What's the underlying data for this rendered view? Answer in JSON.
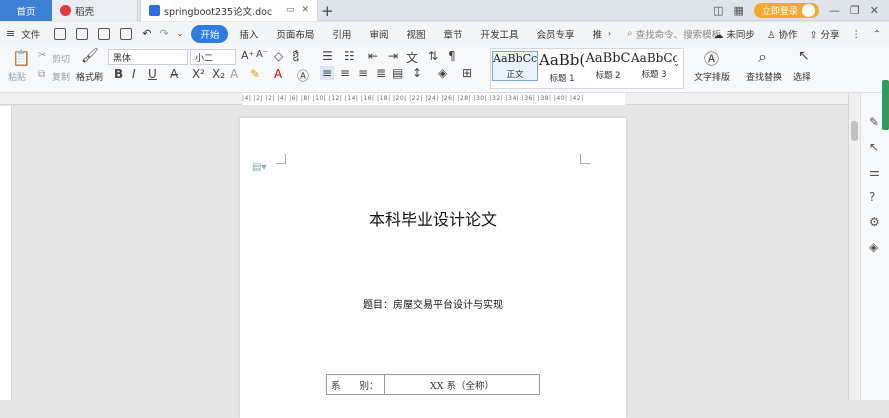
{
  "tabs": {
    "home": "首页",
    "daoke": "稻壳",
    "doc": "springboot235论文.doc"
  },
  "window": {
    "login_label": "立即登录"
  },
  "menu": {
    "file": "文件",
    "items": [
      "开始",
      "插入",
      "页面布局",
      "引用",
      "审阅",
      "视图",
      "章节",
      "开发工具",
      "会员专享",
      "推"
    ],
    "search_placeholder": "查找命令、搜索模板",
    "sync": "未同步",
    "collab": "协作",
    "share": "分享"
  },
  "ribbon": {
    "paste": "粘贴",
    "cut": "剪切",
    "copy": "复制",
    "format_painter": "格式刷",
    "font_name": "黑体",
    "font_size": "小二",
    "styles": [
      {
        "preview": "AaBbCcI",
        "label": "正文"
      },
      {
        "preview": "AaBb(",
        "label": "标题 1"
      },
      {
        "preview": "AaBbC",
        "label": "标题 2"
      },
      {
        "preview": "AaBbCc",
        "label": "标题 3"
      }
    ],
    "text_layout": "文字排版",
    "find_replace": "查找替换",
    "select": "选择"
  },
  "ruler": {
    "marks": "|4| |2| |2| |4| |6| |8| |10| |12| |14| |16| |18| |20| |22| |24| |26| |28| |30| |32| |34| |36| |38| |40| |42|"
  },
  "document": {
    "title": "本科毕业设计论文",
    "subtitle": "题目：房屋交易平台设计与实现",
    "table": {
      "label": "系　　别：",
      "value": "XX 系（全称）"
    }
  }
}
